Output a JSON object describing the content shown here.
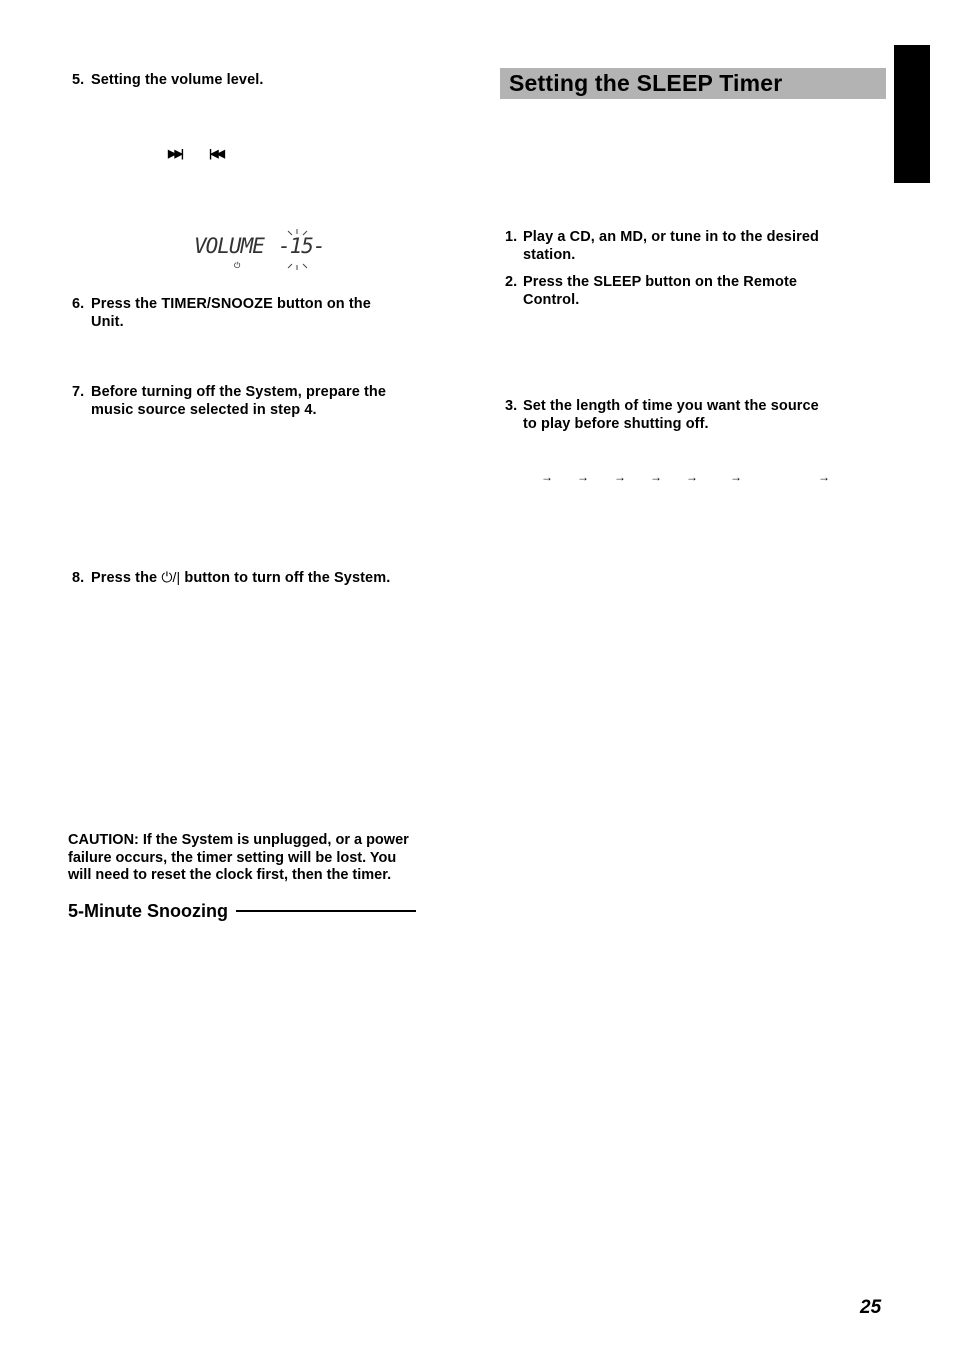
{
  "left_column": {
    "step5": {
      "number": "5.",
      "text": "Setting the volume level."
    },
    "skip_buttons": {
      "next_icon": "▶▶|",
      "prev_icon": "|◀◀"
    },
    "lcd_display": {
      "label": "VOLUME",
      "value": "-15-",
      "timer_indicator": "⏻"
    },
    "step6": {
      "number": "6.",
      "line1": "Press the TIMER/SNOOZE button on the",
      "line2": "Unit."
    },
    "step7": {
      "number": "7.",
      "line1": "Before turning off the System, prepare the",
      "line2": "music source selected in step 4."
    },
    "step8": {
      "number": "8.",
      "before": "Press the ",
      "power_symbol": "⏻/|",
      "after": " button to turn off the System."
    },
    "caution": {
      "line1": "CAUTION: If the System is unplugged, or a power",
      "line2": "failure occurs, the timer setting will be lost. You",
      "line3": "will need to reset the clock first, then the timer."
    },
    "section_heading": "5-Minute Snoozing"
  },
  "right_column": {
    "title": "Setting the SLEEP Timer",
    "step1": {
      "number": "1.",
      "line1": "Play a CD, an MD, or tune in to the desired",
      "line2": "station."
    },
    "step2": {
      "number": "2.",
      "line1": "Press the SLEEP button on the Remote",
      "line2": "Control."
    },
    "step3": {
      "number": "3.",
      "line1": "Set the length of time you want the source",
      "line2": "to play before shutting off."
    },
    "sequence_arrows": [
      "→",
      "→",
      "→",
      "→",
      "→",
      "→",
      "→"
    ]
  },
  "page_number": "25"
}
